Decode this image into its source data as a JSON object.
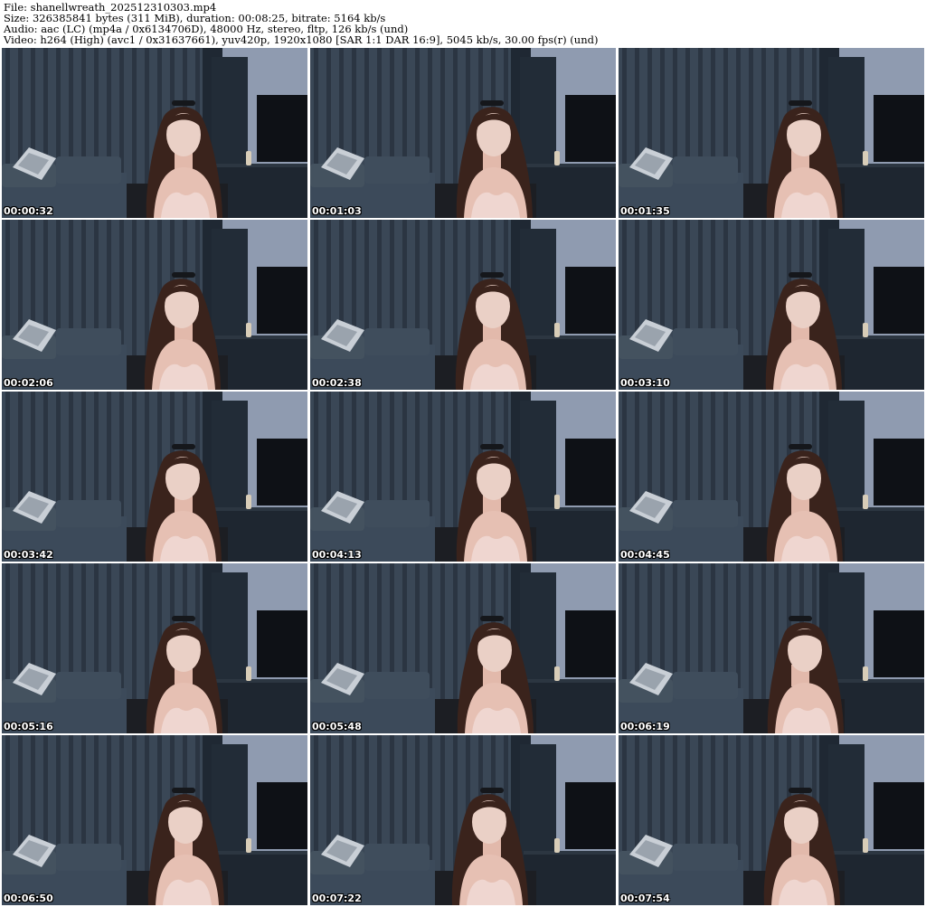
{
  "header": {
    "file_line": "File: shanellwreath_202512310303.mp4",
    "size_line": "Size: 326385841 bytes (311 MiB), duration: 00:08:25, bitrate: 5164 kb/s",
    "audio_line": "Audio: aac (LC) (mp4a / 0x6134706D), 48000 Hz, stereo, fltp, 126 kb/s (und)",
    "video_line": "Video: h264 (High) (avc1 / 0x31637661), yuv420p, 1920x1080 [SAR 1:1 DAR 16:9], 5045 kb/s, 30.00 fps(r) (und)"
  },
  "thumbnails": [
    {
      "timestamp": "00:00:32"
    },
    {
      "timestamp": "00:01:03"
    },
    {
      "timestamp": "00:01:35"
    },
    {
      "timestamp": "00:02:06"
    },
    {
      "timestamp": "00:02:38"
    },
    {
      "timestamp": "00:03:10"
    },
    {
      "timestamp": "00:03:42"
    },
    {
      "timestamp": "00:04:13"
    },
    {
      "timestamp": "00:04:45"
    },
    {
      "timestamp": "00:05:16"
    },
    {
      "timestamp": "00:05:48"
    },
    {
      "timestamp": "00:06:19"
    },
    {
      "timestamp": "00:06:50"
    },
    {
      "timestamp": "00:07:22"
    },
    {
      "timestamp": "00:07:54"
    }
  ],
  "colors": {
    "curtain": "#3a4756",
    "wall": "#8f9bb0",
    "sofa": "#3c4a5a",
    "cabinet": "#1e2630",
    "tv": "#0e1116",
    "skin": "#e6c0b3",
    "hair": "#3a231c",
    "top": "#efd6d0"
  }
}
